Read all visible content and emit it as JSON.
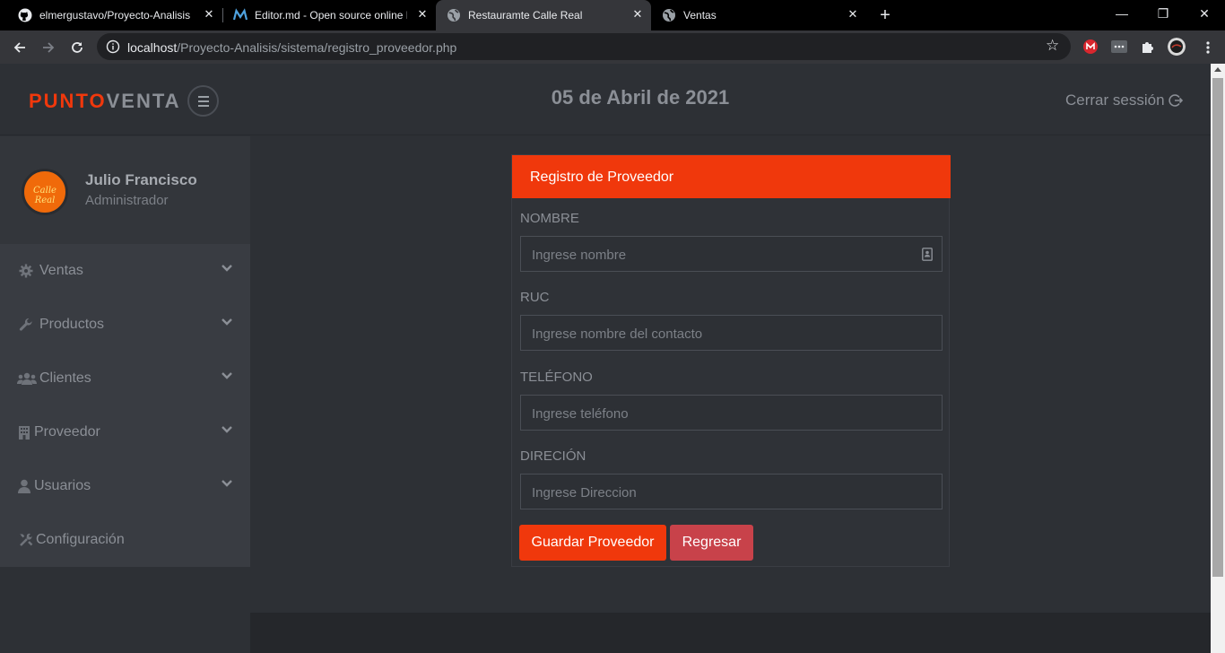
{
  "browser": {
    "tabs": [
      {
        "title": "elmergustavo/Proyecto-Analisis",
        "icon": "github-icon"
      },
      {
        "title": "Editor.md - Open source online Markdown editor",
        "icon": "editormd-icon"
      },
      {
        "title": "Restauramte Calle Real",
        "icon": "globe-icon"
      },
      {
        "title": "Ventas",
        "icon": "globe-icon"
      }
    ],
    "url_host": "localhost",
    "url_path": "/Proyecto-Analisis/sistema/registro_proveedor.php",
    "accent": "#f0380c"
  },
  "header": {
    "brand_part1": "PUNTO",
    "brand_part2": "VENTA",
    "date": "05 de Abril de 2021",
    "logout_label": "Cerrar sessión"
  },
  "sidebar": {
    "user_name": "Julio Francisco",
    "user_role": "Administrador",
    "avatar_text": "Calle Real",
    "items": [
      {
        "label": "Ventas",
        "icon": "gear-icon"
      },
      {
        "label": "Productos",
        "icon": "wrench-icon"
      },
      {
        "label": "Clientes",
        "icon": "users-icon"
      },
      {
        "label": "Proveedor",
        "icon": "building-icon"
      },
      {
        "label": "Usuarios",
        "icon": "user-icon"
      },
      {
        "label": "Configuración",
        "icon": "tools-icon"
      }
    ]
  },
  "form": {
    "title": "Registro de Proveedor",
    "fields": [
      {
        "label": "NOMBRE",
        "placeholder": "Ingrese nombre"
      },
      {
        "label": "RUC",
        "placeholder": "Ingrese nombre del contacto"
      },
      {
        "label": "TELÉFONO",
        "placeholder": "Ingrese teléfono"
      },
      {
        "label": "DIRECIÓN",
        "placeholder": "Ingrese Direccion"
      }
    ],
    "save_label": "Guardar Proveedor",
    "back_label": "Regresar"
  }
}
